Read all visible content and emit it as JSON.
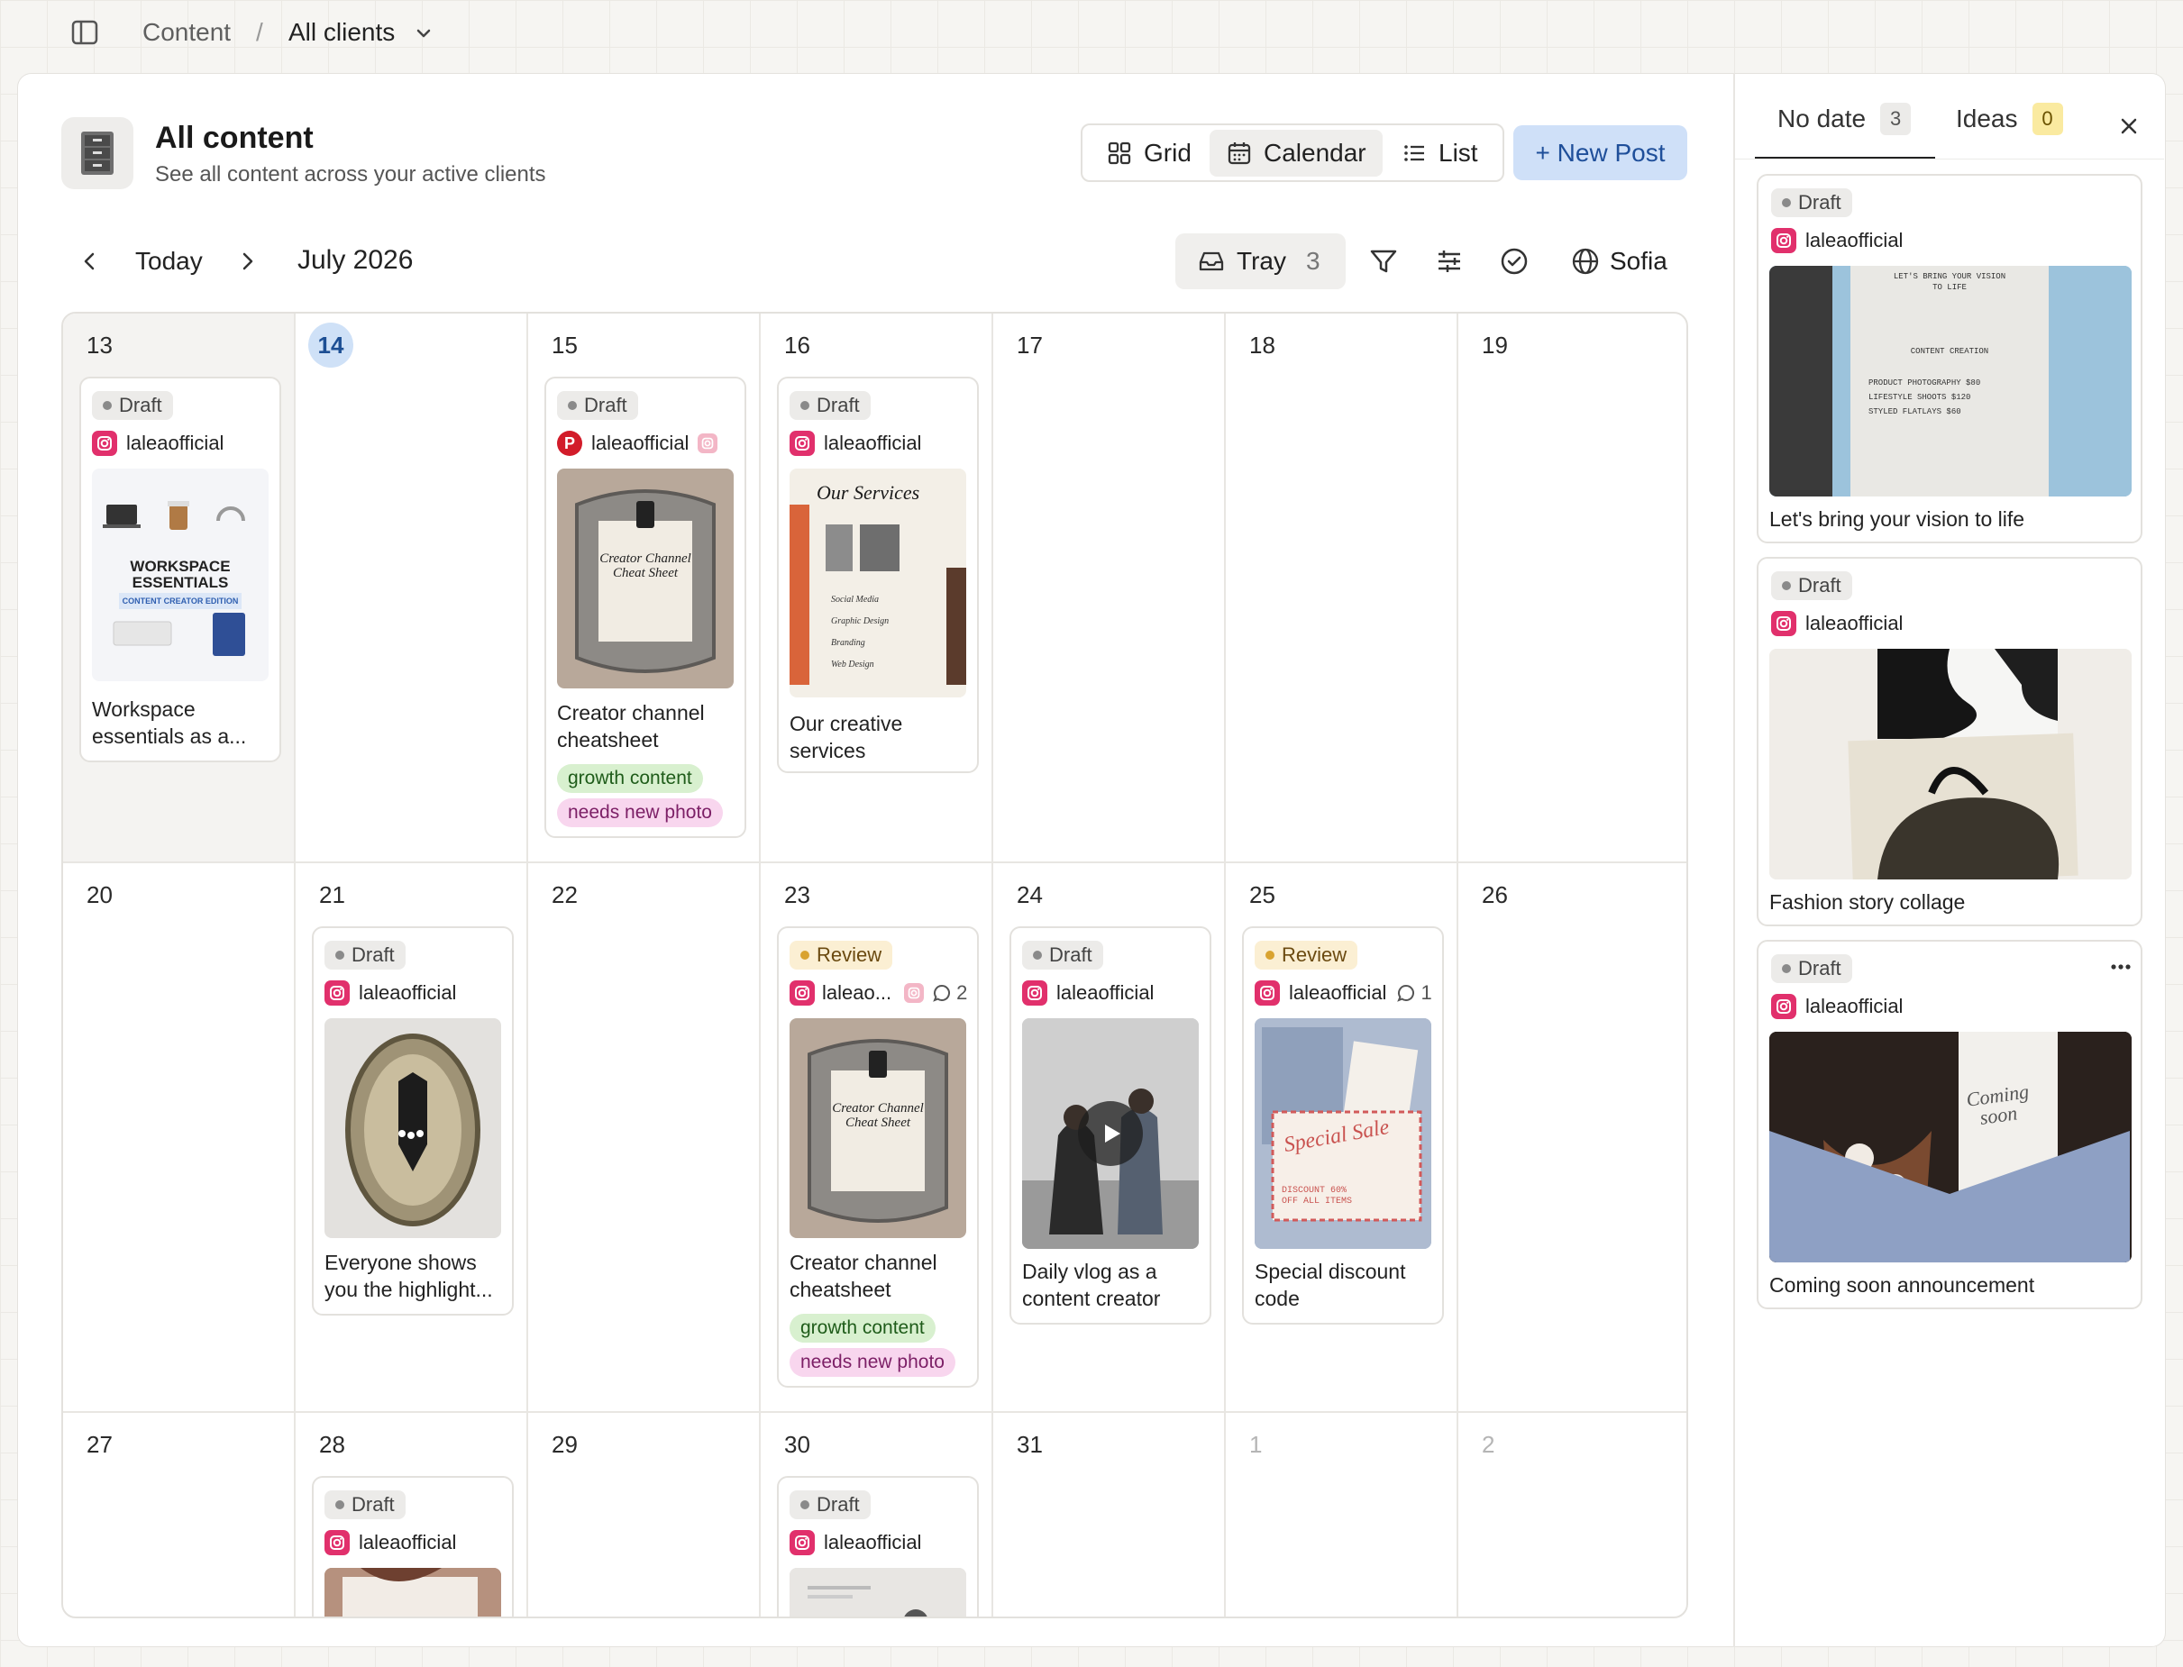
{
  "breadcrumb": {
    "root": "Content",
    "separator": "/",
    "current": "All clients"
  },
  "header": {
    "title": "All content",
    "subtitle": "See all content across your active clients"
  },
  "views": {
    "grid": "Grid",
    "calendar": "Calendar",
    "list": "List",
    "active": "Calendar"
  },
  "new_post_label": "+ New Post",
  "nav": {
    "today": "Today",
    "month": "July 2026"
  },
  "toolbar": {
    "tray_label": "Tray",
    "tray_count": "3",
    "timezone": "Sofia"
  },
  "calendar": {
    "days": [
      "13",
      "14",
      "15",
      "16",
      "17",
      "18",
      "19",
      "20",
      "21",
      "22",
      "23",
      "24",
      "25",
      "26",
      "27",
      "28",
      "29",
      "30",
      "31",
      "1",
      "2"
    ],
    "today": "14",
    "posts": [
      {
        "day": "13",
        "status": "Draft",
        "account": "laleaofficial",
        "title1": "Workspace",
        "title2": "essentials as a..."
      },
      {
        "day": "15",
        "status": "Draft",
        "account": "laleaofficial",
        "title1": "Creator channel",
        "title2": "cheatsheet",
        "tags": [
          "growth content",
          "needs new photo"
        ]
      },
      {
        "day": "16",
        "status": "Draft",
        "account": "laleaofficial",
        "title1": "Our creative",
        "title2": "services"
      },
      {
        "day": "21",
        "status": "Draft",
        "account": "laleaofficial",
        "title1": "Everyone shows",
        "title2": "you the highlight..."
      },
      {
        "day": "23",
        "status": "Review",
        "account": "laleao...",
        "comments": "2",
        "title1": "Creator channel",
        "title2": "cheatsheet",
        "tags": [
          "growth content",
          "needs new photo"
        ]
      },
      {
        "day": "24",
        "status": "Draft",
        "account": "laleaofficial",
        "title1": "Daily vlog as a",
        "title2": "content creator"
      },
      {
        "day": "25",
        "status": "Review",
        "account": "laleaofficial",
        "comments": "1",
        "title1": "Special discount",
        "title2": "code"
      },
      {
        "day": "28",
        "status": "Draft",
        "account": "laleaofficial"
      },
      {
        "day": "30",
        "status": "Draft",
        "account": "laleaofficial"
      }
    ]
  },
  "thumb_text": {
    "workspace": {
      "line1": "WORKSPACE",
      "line2": "ESSENTIALS",
      "line3": "CONTENT CREATOR EDITION"
    },
    "cheatsheet": {
      "line1": "Creator Channel",
      "line2": "Cheat Sheet"
    },
    "services": {
      "line1": "Our Services",
      "items": [
        "Social Media",
        "Graphic Design",
        "Branding",
        "Web Design"
      ]
    },
    "sale": {
      "line1": "Special Sale",
      "line2": "DISCOUNT 60%",
      "line3": "OFF ALL ITEMS"
    },
    "vision": {
      "line1": "LET'S BRING YOUR VISION",
      "line2": "TO LIFE",
      "line3": "CONTENT CREATION",
      "line4": "PRODUCT PHOTOGRAPHY  $80",
      "line5": "LIFESTYLE SHOOTS  $120",
      "line6": "STYLED FLATLAYS  $60"
    },
    "coming": {
      "line1": "Coming",
      "line2": "soon"
    }
  },
  "side_panel": {
    "tabs": [
      {
        "label": "No date",
        "count": "3"
      },
      {
        "label": "Ideas",
        "count": "0"
      }
    ],
    "cards": [
      {
        "status": "Draft",
        "account": "laleaofficial",
        "title": "Let's bring your vision to life"
      },
      {
        "status": "Draft",
        "account": "laleaofficial",
        "title": "Fashion story collage"
      },
      {
        "status": "Draft",
        "account": "laleaofficial",
        "title": "Coming soon announcement"
      }
    ]
  },
  "colors": {
    "accent": "#cfe0f8",
    "instagram": "#e1306c",
    "pinterest": "#d21c2a",
    "tag_green": "#d8f0cf",
    "tag_pink": "#f8d6ee",
    "review": "#fbefd3"
  }
}
